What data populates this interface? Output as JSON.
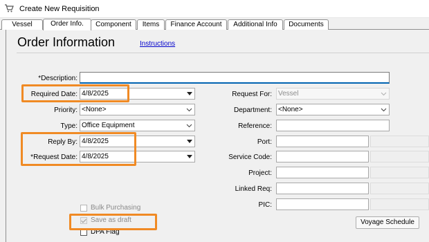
{
  "window": {
    "title": "Create New Requisition",
    "icon": "cart-icon"
  },
  "tabs": [
    {
      "label": "Vessel",
      "active": false
    },
    {
      "label": "Order Info.",
      "active": true
    },
    {
      "label": "Component",
      "active": false
    },
    {
      "label": "Items",
      "active": false
    },
    {
      "label": "Finance Account",
      "active": false
    },
    {
      "label": "Additional Info",
      "active": false
    },
    {
      "label": "Documents",
      "active": false
    }
  ],
  "page": {
    "title": "Order Information",
    "instructions_link": "Instructions"
  },
  "required_marker": "*",
  "left_form": {
    "description": {
      "label": "Description:",
      "value": ""
    },
    "required_date": {
      "label": "Required Date:",
      "value": "4/8/2025"
    },
    "priority": {
      "label": "Priority:",
      "value": "<None>"
    },
    "type": {
      "label": "Type:",
      "value": "Office Equipment"
    },
    "reply_by": {
      "label": "Reply By:",
      "value": "4/8/2025"
    },
    "request_date": {
      "label": "Request Date:",
      "value": "4/8/2025"
    }
  },
  "right_form": {
    "request_for": {
      "label": "Request For:",
      "value": "Vessel"
    },
    "department": {
      "label": "Department:",
      "value": "<None>"
    },
    "reference": {
      "label": "Reference:",
      "value": ""
    },
    "port": {
      "label": "Port:",
      "value": ""
    },
    "service_code": {
      "label": "Service Code:",
      "value": ""
    },
    "project": {
      "label": "Project:",
      "value": ""
    },
    "linked_req": {
      "label": "Linked Req:",
      "value": ""
    },
    "pic": {
      "label": "PIC:",
      "value": ""
    }
  },
  "checkboxes": {
    "bulk_purchasing": {
      "label": "Bulk Purchasing",
      "checked": false,
      "enabled": false
    },
    "save_as_draft": {
      "label": "Save as draft",
      "checked": true,
      "enabled": false
    },
    "dpa_flag": {
      "label": "DPA Flag",
      "checked": false,
      "enabled": true
    }
  },
  "buttons": {
    "voyage_schedule": "Voyage Schedule"
  },
  "colors": {
    "highlight": "#f08a24",
    "link": "#0000cc",
    "focus_underline": "#0063b1"
  }
}
